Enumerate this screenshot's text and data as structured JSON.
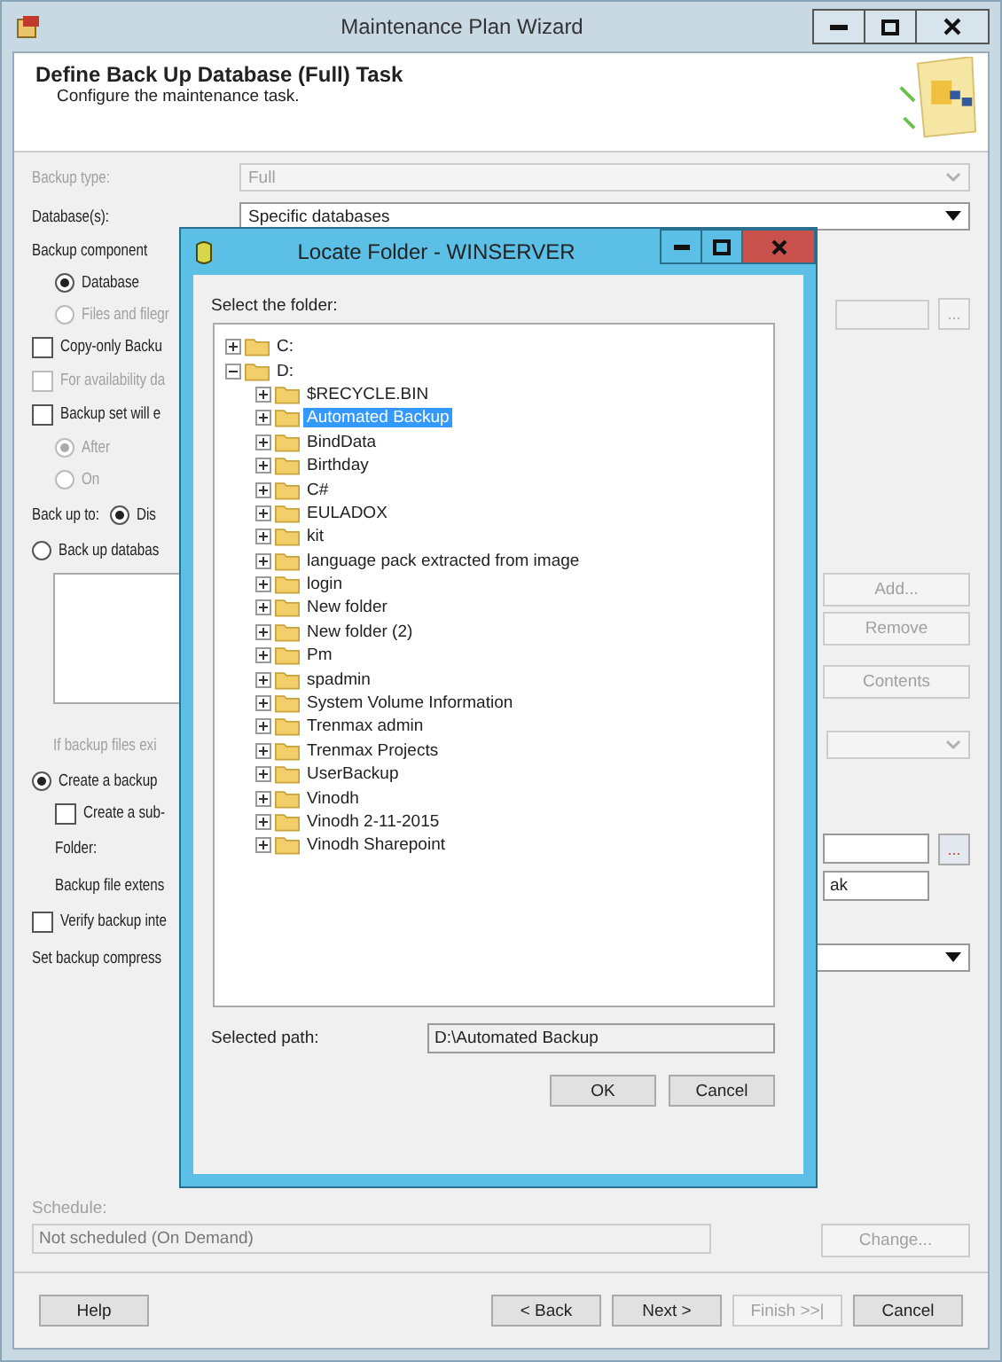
{
  "window": {
    "title": "Maintenance Plan Wizard"
  },
  "header": {
    "title": "Define Back Up Database (Full) Task",
    "subtitle": "Configure the maintenance task."
  },
  "rows": [
    {
      "kind": "dropdown",
      "label": "Backup type:",
      "value": "Full",
      "disabled": true
    },
    {
      "kind": "dropdown",
      "label": "Database(s):",
      "value": "Specific databases",
      "disabled": false
    },
    {
      "kind": "label",
      "label": "Backup component",
      "children": [
        {
          "kind": "radio",
          "label": "Database",
          "selected": true,
          "disabled": false
        },
        {
          "kind": "radio_field",
          "label": "Files and filegr",
          "selected": false,
          "disabled": true,
          "button": "..."
        }
      ]
    },
    {
      "kind": "checkbox",
      "label": "Copy-only Backu",
      "checked": false,
      "disabled": false
    },
    {
      "kind": "checkbox",
      "label": "For availability da",
      "checked": false,
      "disabled": true
    },
    {
      "kind": "checkbox",
      "label": "Backup set will e",
      "checked": false,
      "disabled": false,
      "children": [
        {
          "kind": "radio",
          "label": "After",
          "selected": true,
          "disabled": true
        },
        {
          "kind": "radio",
          "label": "On",
          "selected": false,
          "disabled": true
        }
      ]
    },
    {
      "kind": "backup_to",
      "label": "Back up to:",
      "option": "Dis",
      "selected": true
    },
    {
      "kind": "radio",
      "label": "Back up databas",
      "selected": false,
      "disabled": false
    },
    {
      "kind": "listbox",
      "buttons": [
        {
          "label": "Add...",
          "disabled": true
        },
        {
          "label": "Remove",
          "disabled": true
        },
        {
          "label": "Contents",
          "disabled": true
        }
      ]
    },
    {
      "kind": "hint",
      "label": "If backup files exi"
    },
    {
      "kind": "radio",
      "label": "Create a backup",
      "selected": true,
      "disabled": false,
      "children": [
        {
          "kind": "checkbox",
          "label": "Create a sub-",
          "checked": false,
          "disabled": false
        },
        {
          "kind": "field",
          "label": "Folder:",
          "button": "..."
        },
        {
          "kind": "field",
          "label": "Backup file extens",
          "value": "ak"
        }
      ]
    },
    {
      "kind": "checkbox",
      "label": "Verify backup inte",
      "checked": false,
      "disabled": false
    },
    {
      "kind": "dropdown",
      "label": "Set backup compress",
      "value": "",
      "disabled": false
    }
  ],
  "schedule": {
    "label": "Schedule:",
    "value": "Not scheduled (On Demand)",
    "button": "Change..."
  },
  "footer": {
    "left": [
      {
        "label": "Help",
        "disabled": false
      }
    ],
    "right": [
      {
        "label": "< Back",
        "disabled": false
      },
      {
        "label": "Next >",
        "disabled": false
      },
      {
        "label": "Finish >>|",
        "disabled": true
      },
      {
        "label": "Cancel",
        "disabled": false
      }
    ]
  },
  "dialog": {
    "title": "Locate Folder - WINSERVER",
    "prompt": "Select the folder:",
    "tree": [
      {
        "label": "C:",
        "expanded": false,
        "selected": false
      },
      {
        "label": "D:",
        "expanded": true,
        "selected": false,
        "children": [
          {
            "label": "$RECYCLE.BIN",
            "expanded": false,
            "selected": false
          },
          {
            "label": "Automated Backup",
            "expanded": false,
            "selected": true
          },
          {
            "label": "BindData",
            "expanded": false,
            "selected": false
          },
          {
            "label": "Birthday",
            "expanded": false,
            "selected": false
          },
          {
            "label": "C#",
            "expanded": false,
            "selected": false
          },
          {
            "label": "EULADOX",
            "expanded": false,
            "selected": false
          },
          {
            "label": "kit",
            "expanded": false,
            "selected": false
          },
          {
            "label": "language pack extracted from image",
            "expanded": false,
            "selected": false
          },
          {
            "label": "login",
            "expanded": false,
            "selected": false
          },
          {
            "label": "New folder",
            "expanded": false,
            "selected": false
          },
          {
            "label": "New folder (2)",
            "expanded": false,
            "selected": false
          },
          {
            "label": "Pm",
            "expanded": false,
            "selected": false
          },
          {
            "label": "spadmin",
            "expanded": false,
            "selected": false
          },
          {
            "label": "System Volume Information",
            "expanded": false,
            "selected": false
          },
          {
            "label": "Trenmax admin",
            "expanded": false,
            "selected": false
          },
          {
            "label": "Trenmax Projects",
            "expanded": false,
            "selected": false
          },
          {
            "label": "UserBackup",
            "expanded": false,
            "selected": false
          },
          {
            "label": "Vinodh",
            "expanded": false,
            "selected": false
          },
          {
            "label": "Vinodh 2-11-2015",
            "expanded": false,
            "selected": false
          },
          {
            "label": "Vinodh Sharepoint",
            "expanded": false,
            "selected": false
          }
        ]
      }
    ],
    "path_label": "Selected path:",
    "path": "D:\\Automated Backup",
    "buttons": [
      "OK",
      "Cancel"
    ]
  }
}
